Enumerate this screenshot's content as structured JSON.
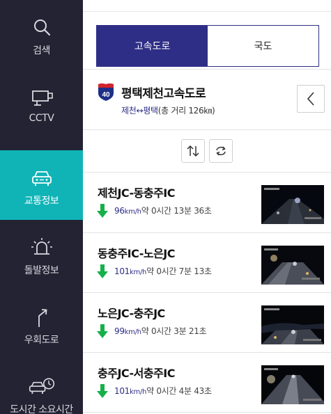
{
  "sidebar": {
    "items": [
      {
        "label": "검색",
        "icon": "search-icon",
        "active": false
      },
      {
        "label": "CCTV",
        "icon": "cctv-icon",
        "active": false
      },
      {
        "label": "교통정보",
        "icon": "car-icon",
        "active": true
      },
      {
        "label": "돌발정보",
        "icon": "siren-icon",
        "active": false
      },
      {
        "label": "우회도로",
        "icon": "detour-icon",
        "active": false
      },
      {
        "label": "도시간 소요시간",
        "icon": "car-clock-icon",
        "active": false
      }
    ]
  },
  "tabs": [
    {
      "label": "고속도로",
      "active": true
    },
    {
      "label": "국도",
      "active": false
    }
  ],
  "route": {
    "number": "40",
    "name": "평택제천고속도로",
    "from_to": "제천↔평택",
    "distance_text": "(총 거리 126㎞)"
  },
  "segments": [
    {
      "name": "제천JC-동충주IC",
      "speed": "96",
      "unit": "km/h",
      "time": "약 0시간 13분 36초"
    },
    {
      "name": "동충주IC-노은JC",
      "speed": "101",
      "unit": "km/h",
      "time": "약 0시간 7분 13초"
    },
    {
      "name": "노은JC-충주JC",
      "speed": "99",
      "unit": "km/h",
      "time": "약 0시간 3분 21초"
    },
    {
      "name": "충주JC-서충주IC",
      "speed": "101",
      "unit": "km/h",
      "time": "약 0시간 4분 43초"
    }
  ],
  "colors": {
    "sidebar_bg": "#232333",
    "active_nav": "#10b4b7",
    "accent": "#2e2e86",
    "speed_arrow": "#16b04a"
  }
}
